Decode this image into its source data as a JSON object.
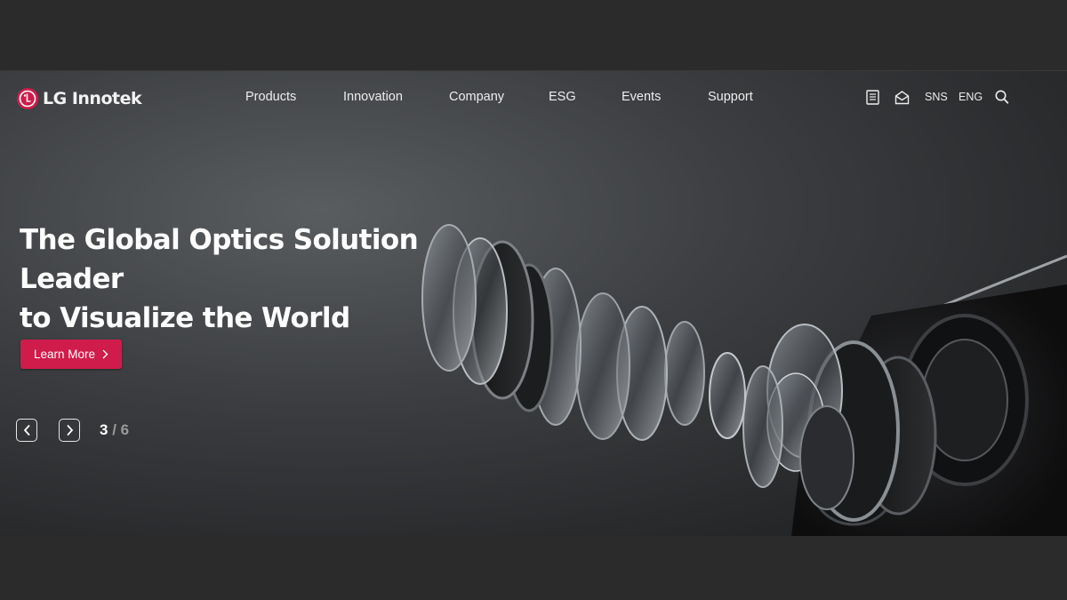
{
  "brand": {
    "name": "LG Innotek",
    "accent": "#d01c4b"
  },
  "nav": {
    "items": [
      {
        "label": "Products"
      },
      {
        "label": "Innovation"
      },
      {
        "label": "Company"
      },
      {
        "label": "ESG"
      },
      {
        "label": "Events"
      },
      {
        "label": "Support"
      }
    ]
  },
  "utilities": {
    "newsroom_icon": "newspaper-icon",
    "mail_icon": "mail-icon",
    "sns_label": "SNS",
    "language_label": "ENG",
    "search_icon": "search-icon"
  },
  "hero": {
    "headline_line1": "The Global Optics Solution Leader",
    "headline_line2": "to Visualize the World",
    "cta_label": "Learn More",
    "slider": {
      "current": "3",
      "separator": "/",
      "total": "6",
      "prev_icon": "chevron-left-icon",
      "next_icon": "chevron-right-icon"
    }
  }
}
